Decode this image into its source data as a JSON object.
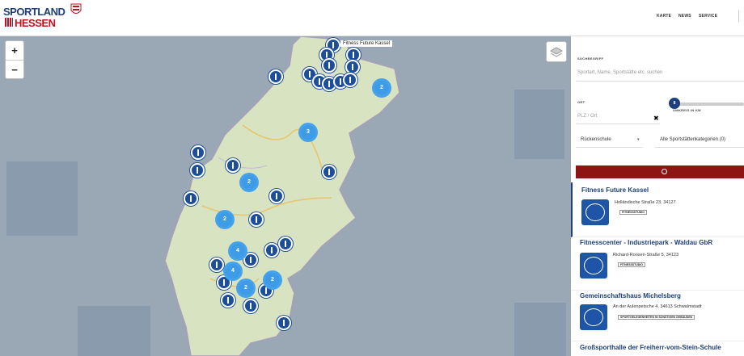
{
  "header": {
    "logo": {
      "line1": "SPORTLAND",
      "line2": "HESSEN"
    },
    "nav": [
      "KARTE",
      "NEWS",
      "SERVICE"
    ]
  },
  "map": {
    "zoom_in": "+",
    "zoom_out": "−",
    "tooltip": "Fitness Future Kassel",
    "clusters": [
      "2",
      "3",
      "2",
      "2",
      "4",
      "4",
      "2",
      "2"
    ]
  },
  "search": {
    "keyword_label": "SUCHBEGRIFF",
    "keyword_placeholder": "Sportart, Name, Sportstätte etc. suchen",
    "location_label": "ORT",
    "location_placeholder": "PLZ / Ort",
    "clear": "✖",
    "radius_value": "8",
    "radius_label": "UMKREIS IN KM",
    "sport_select": "Rückenschule",
    "category_select": "Alle Sportstättenkategorien (0)"
  },
  "results": [
    {
      "title": "Fitness Future Kassel",
      "address": "Holländische Straße 23, 34127",
      "tag": "FITNESSSTUDIO"
    },
    {
      "title": "Fitnesscenter - Industriepark - Waldau GbR",
      "address": "Richard-Roosen-Straße 5, 34123",
      "tag": "FITNESSSTUDIO"
    },
    {
      "title": "Gemeinschaftshaus Michelsberg",
      "address": "An der Aulenpetsche 4, 34613 Schwalmstadt",
      "tag": "SPORTGELEGENHEITEN IN SONSTIGEN GEBÄUDEN"
    },
    {
      "title": "Großsporthalle der Freiherr-vom-Stein-Schule",
      "address": "",
      "tag": ""
    }
  ]
}
